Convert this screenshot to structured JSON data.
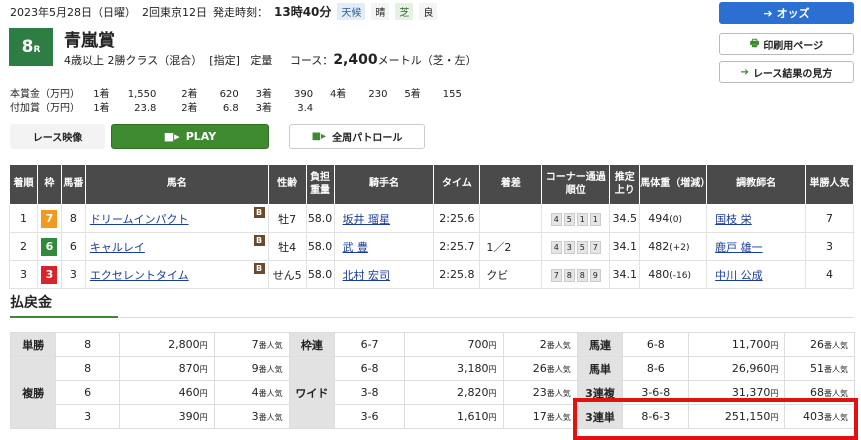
{
  "header": {
    "date": "2023年5月28日（日曜）",
    "meeting": "2回東京12日",
    "start_label": "発走時刻：",
    "start_time": "13時40分",
    "weather_label": "天候",
    "weather": "晴",
    "turf_label": "芝",
    "turf_cond": "良"
  },
  "race": {
    "number": "8",
    "suffix": "R",
    "name": "青嵐賞",
    "cond1": "4歳以上",
    "cond2": "2勝クラス（混合）",
    "cond3": "[指定]",
    "cond4": "定量",
    "course_label": "コース：",
    "distance": "2,400",
    "distance_unit": "メートル（芝・左）"
  },
  "buttons": {
    "odds": "オッズ",
    "print": "印刷用ページ",
    "howto": "レース結果の見方"
  },
  "prizes": {
    "main_label": "本賞金（万円）",
    "main": [
      "1着",
      "1,550",
      "2着",
      "620",
      "3着",
      "390",
      "4着",
      "230",
      "5着",
      "155"
    ],
    "add_label": "付加賞（万円）",
    "add": [
      "1着",
      "23.8",
      "2着",
      "6.8",
      "3着",
      "3.4"
    ]
  },
  "tabs": {
    "video": "レース映像",
    "play": "PLAY",
    "patrol": "全周パトロール"
  },
  "table": {
    "headers": [
      "着順",
      "枠",
      "馬番",
      "馬名",
      "性齢",
      "負担重量",
      "騎手名",
      "タイム",
      "着差",
      "コーナー通過順位",
      "推定上り",
      "馬体重（増減）",
      "調教師名",
      "単勝人気"
    ],
    "rows": [
      {
        "rank": "1",
        "waku": "7",
        "waku_color": "#f29a1d",
        "num": "8",
        "horse": "ドリームインパクト",
        "b": "B",
        "sexage": "牡7",
        "weight": "58.0",
        "jockey": "坂井 瑠星",
        "time": "2:25.6",
        "margin": "",
        "corners": [
          "4",
          "5",
          "1",
          "1"
        ],
        "last3f": "34.5",
        "bw": "494",
        "bwd": "(0)",
        "trainer": "国枝 栄",
        "pop": "7"
      },
      {
        "rank": "2",
        "waku": "6",
        "waku_color": "#2f8a3c",
        "num": "6",
        "horse": "キャルレイ",
        "b": "B",
        "sexage": "牡4",
        "weight": "58.0",
        "jockey": "武 豊",
        "time": "2:25.7",
        "margin": "1／2",
        "corners": [
          "4",
          "3",
          "5",
          "7"
        ],
        "last3f": "34.1",
        "bw": "482",
        "bwd": "(+2)",
        "trainer": "鹿戸 雄一",
        "pop": "3"
      },
      {
        "rank": "3",
        "waku": "3",
        "waku_color": "#d9252a",
        "num": "3",
        "horse": "エクセレントタイム",
        "b": "B",
        "sexage": "せん5",
        "weight": "58.0",
        "jockey": "北村 宏司",
        "time": "2:25.8",
        "margin": "クビ",
        "corners": [
          "7",
          "8",
          "8",
          "9"
        ],
        "last3f": "34.1",
        "bw": "480",
        "bwd": "(-16)",
        "trainer": "中川 公成",
        "pop": "4"
      }
    ]
  },
  "payouts": {
    "title": "払戻金",
    "unit": "円",
    "pop_unit": "番人気",
    "labels": {
      "tansho": "単勝",
      "fukusho": "複勝",
      "wakuren": "枠連",
      "wide": "ワイド",
      "umaren": "馬連",
      "umatan": "馬単",
      "sanrenpuku": "3連複",
      "sanrentan": "3連単"
    },
    "tansho": [
      {
        "combo": "8",
        "pay": "2,800",
        "pop": "7"
      }
    ],
    "fukusho": [
      {
        "combo": "8",
        "pay": "870",
        "pop": "9"
      },
      {
        "combo": "6",
        "pay": "460",
        "pop": "4"
      },
      {
        "combo": "3",
        "pay": "390",
        "pop": "3"
      }
    ],
    "wakuren": [
      {
        "combo": "6-7",
        "pay": "700",
        "pop": "2"
      }
    ],
    "wide": [
      {
        "combo": "6-8",
        "pay": "3,180",
        "pop": "26"
      },
      {
        "combo": "3-8",
        "pay": "2,820",
        "pop": "23"
      },
      {
        "combo": "3-6",
        "pay": "1,610",
        "pop": "17"
      }
    ],
    "umaren": {
      "combo": "6-8",
      "pay": "11,700",
      "pop": "26"
    },
    "umatan": {
      "combo": "8-6",
      "pay": "26,960",
      "pop": "51"
    },
    "sanrenpuku": {
      "combo": "3-6-8",
      "pay": "31,370",
      "pop": "68"
    },
    "sanrentan": {
      "combo": "8-6-3",
      "pay": "251,150",
      "pop": "403"
    }
  }
}
